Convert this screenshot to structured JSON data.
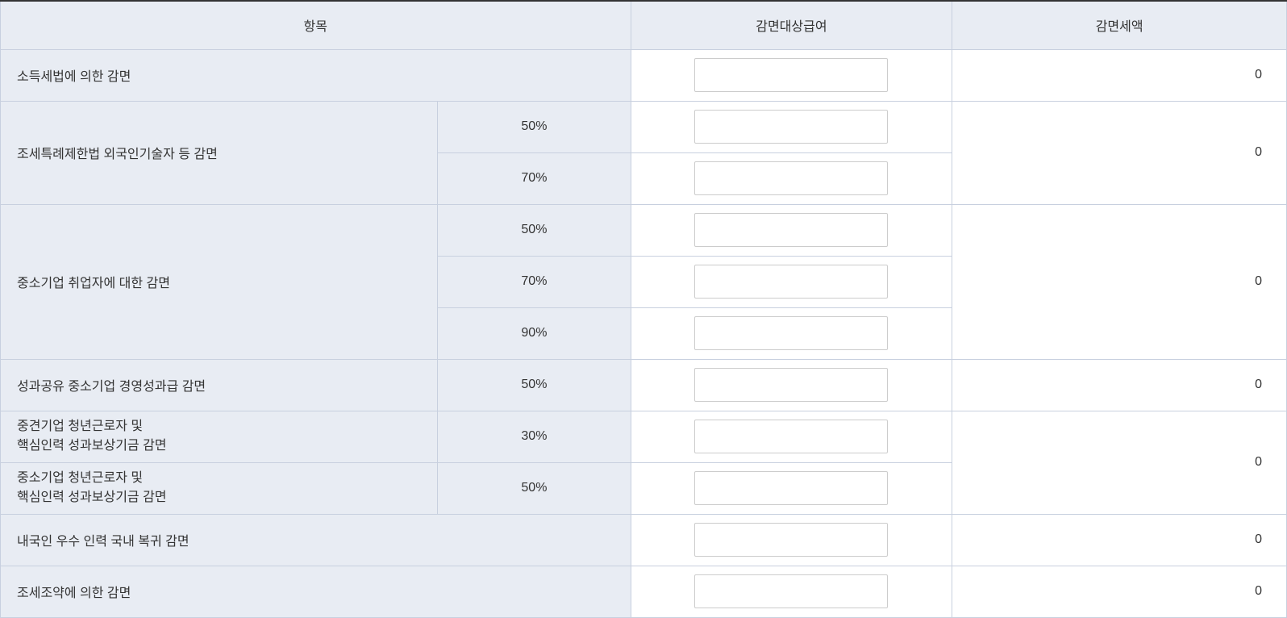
{
  "headers": {
    "item": "항목",
    "eligible_salary": "감면대상급여",
    "reduced_tax": "감면세액"
  },
  "rows": {
    "income_tax_law": {
      "label": "소득세법에 의한 감면",
      "amount": "0"
    },
    "foreign_engineer": {
      "label": "조세특례제한법 외국인기술자 등 감면",
      "rates": {
        "r1": "50%",
        "r2": "70%"
      },
      "amount": "0"
    },
    "sme_employee": {
      "label": "중소기업 취업자에 대한 감면",
      "rates": {
        "r1": "50%",
        "r2": "70%",
        "r3": "90%"
      },
      "amount": "0"
    },
    "performance_sharing": {
      "label": "성과공유 중소기업 경영성과급 감면",
      "rate": "50%",
      "amount": "0"
    },
    "midsize_youth": {
      "label_line1": "중견기업 청년근로자 및",
      "label_line2": "핵심인력 성과보상기금 감면",
      "rate": "30%"
    },
    "sme_youth": {
      "label_line1": "중소기업 청년근로자 및",
      "label_line2": "핵심인력 성과보상기금 감면",
      "rate": "50%",
      "amount": "0"
    },
    "domestic_talent_return": {
      "label": "내국인 우수 인력 국내 복귀 감면",
      "amount": "0"
    },
    "tax_treaty": {
      "label": "조세조약에 의한 감면",
      "amount": "0"
    }
  }
}
